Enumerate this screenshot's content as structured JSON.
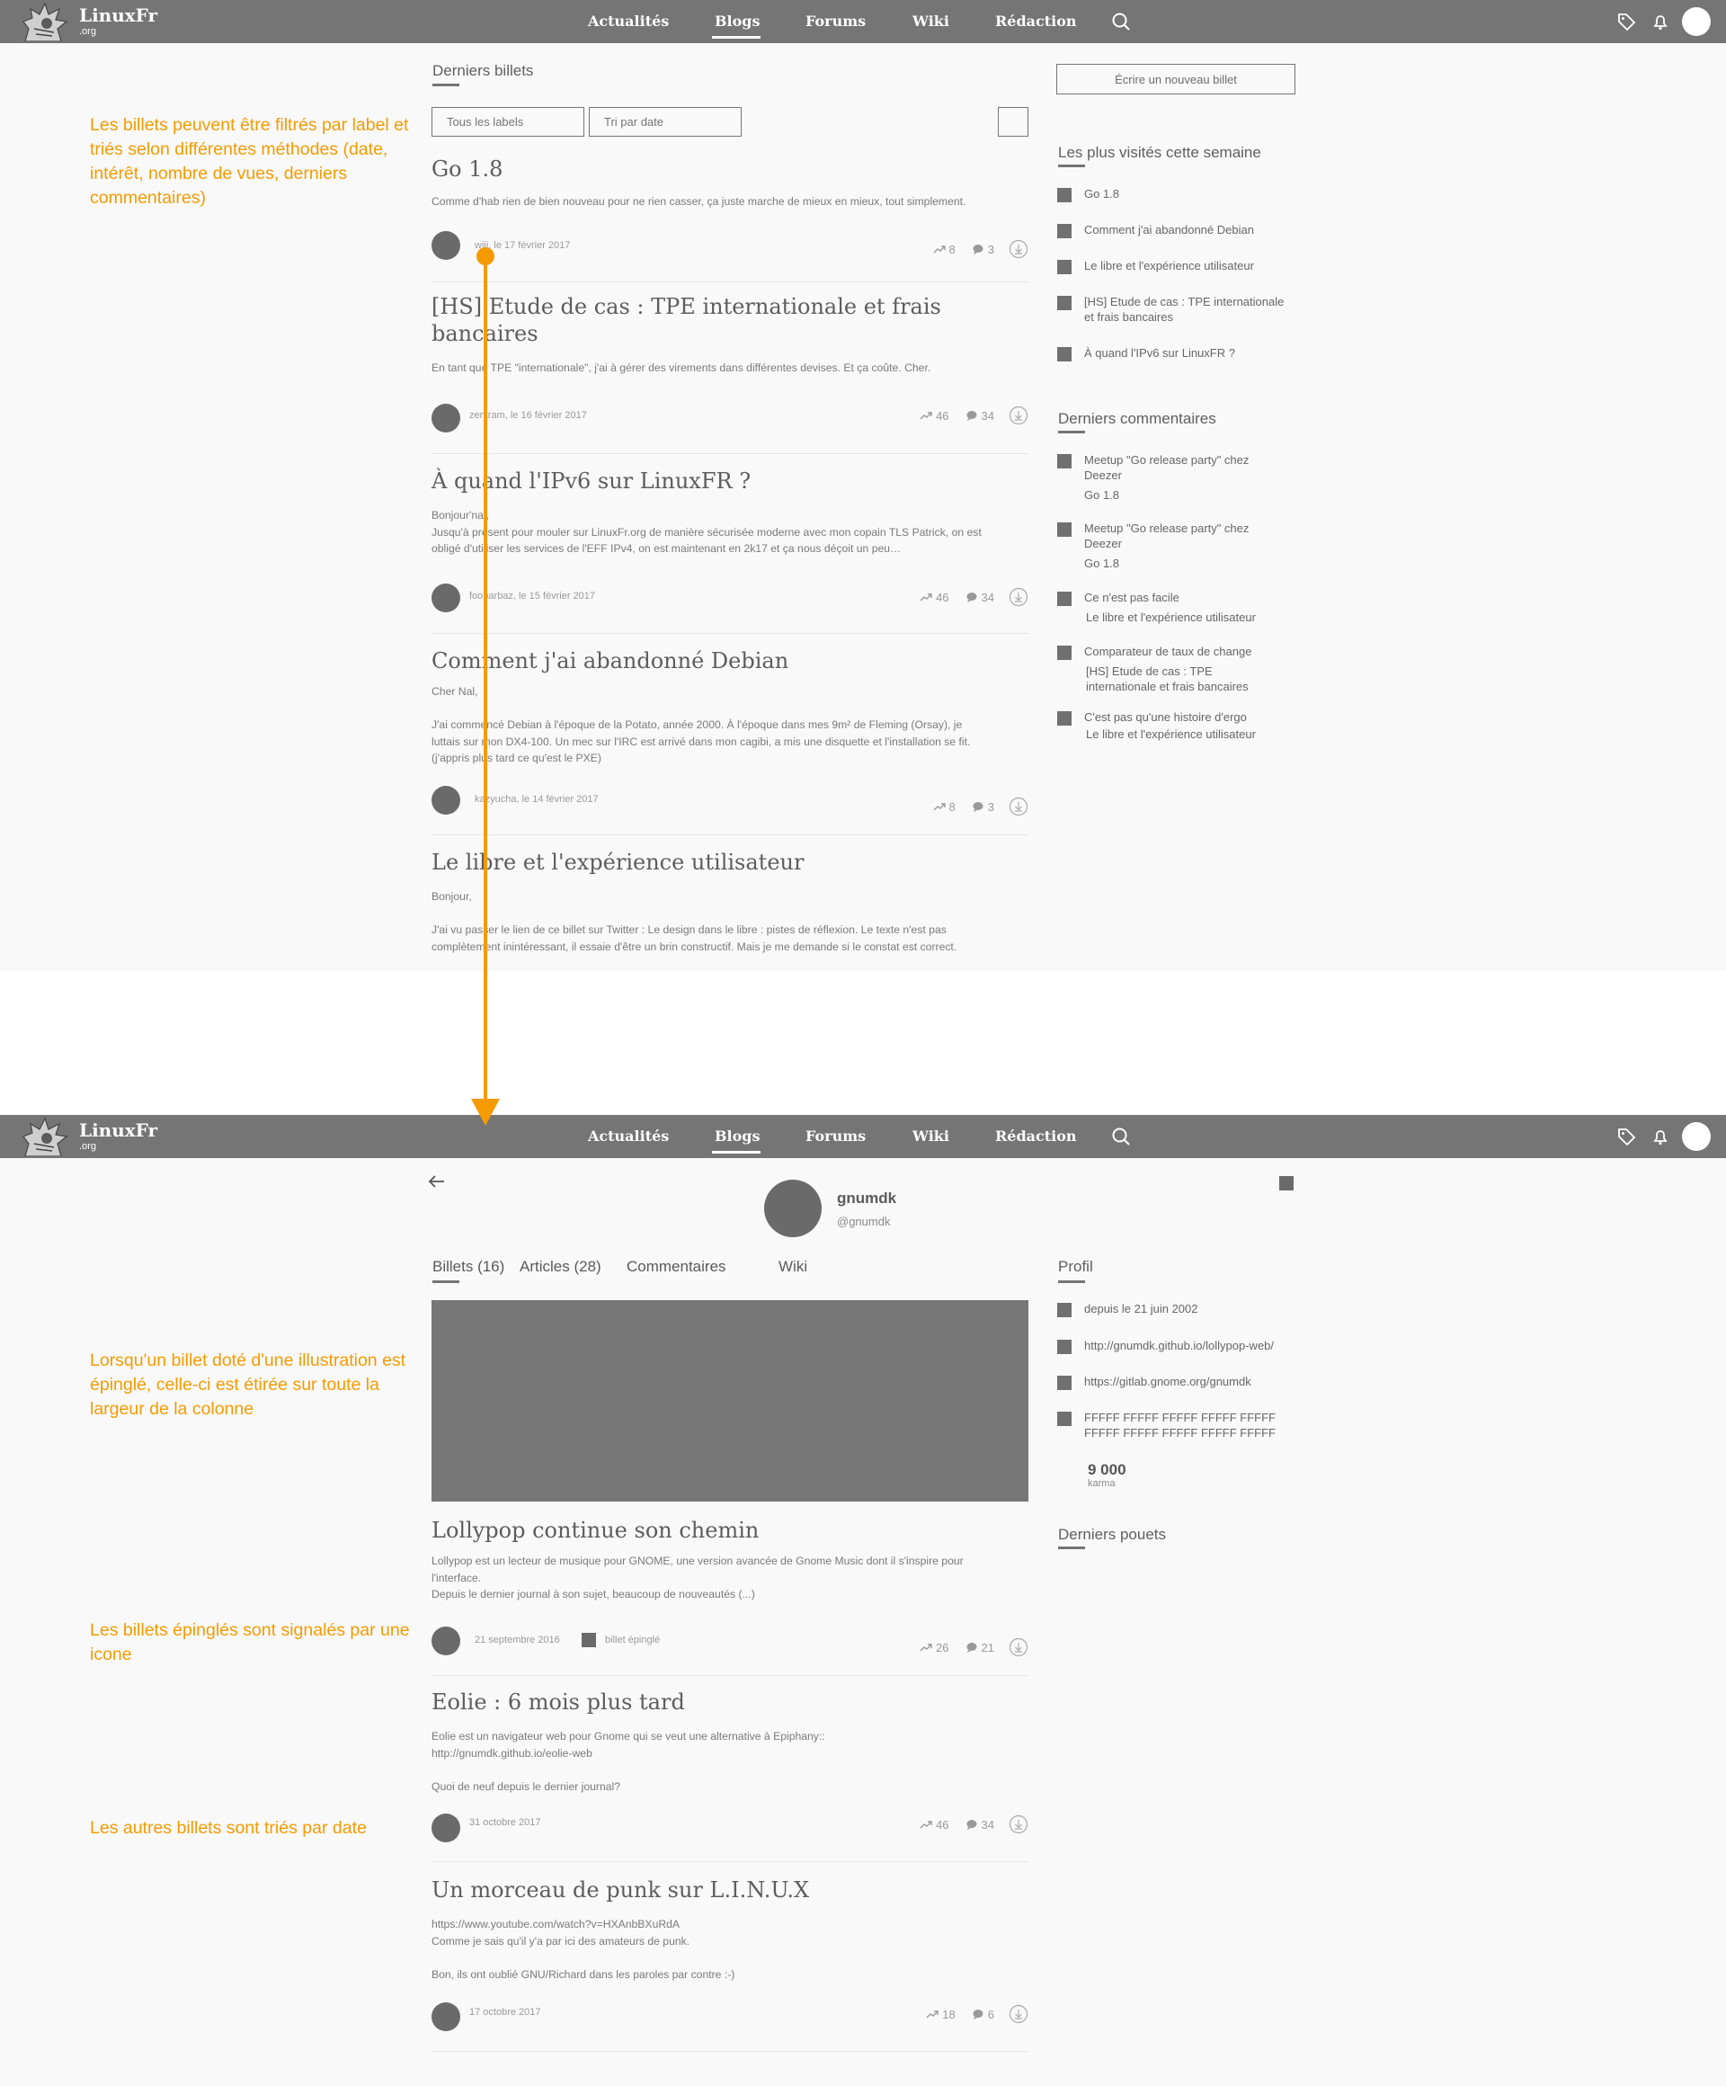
{
  "brand": {
    "name": "LinuxFr",
    "tld": ".org"
  },
  "nav": [
    "Actualités",
    "Blogs",
    "Forums",
    "Wiki",
    "Rédaction"
  ],
  "colors": {
    "header": "#757575",
    "annotation": "#f59b00",
    "background": "#f9f9f9"
  },
  "annotations": {
    "filters": "Les billets peuvent être filtrés par label et triés selon différentes méthodes (date, intérêt, nombre de vues, derniers commentaires)",
    "pinned_illustration": "Lorsqu'un billet doté d'une illustration est épinglé, celle-ci est étirée sur toute la largeur de la colonne",
    "pinned_icon": "Les billets épinglés sont signalés par une icone",
    "sorted_by_date": "Les autres billets sont triés par date"
  },
  "list_view": {
    "section_title": "Derniers billets",
    "filters": {
      "labels": "Tous les labels",
      "sort": "Tri par date"
    },
    "write_button": "Écrire un nouveau billet",
    "posts": [
      {
        "title_lines": [
          "Go 1.8"
        ],
        "excerpt_lines": [
          "Comme d'hab rien de bien nouveau pour ne rien casser, ça juste marche de mieux en mieux, tout simplement."
        ],
        "meta": "wiji, le 17 février 2017",
        "stats": {
          "interest": "8",
          "comments": "3"
        }
      },
      {
        "title_lines": [
          "[HS] Etude de cas : TPE internationale et frais",
          "bancaires"
        ],
        "excerpt_lines": [
          "En tant que TPE \"internationale\", j'ai à gérer des virements dans différentes devises. Et ça coûte. Cher."
        ],
        "meta": "zentram, le 16 février 2017",
        "stats": {
          "interest": "46",
          "comments": "34"
        }
      },
      {
        "title_lines": [
          "À quand l'IPv6 sur LinuxFR ?"
        ],
        "excerpt_lines": [
          "Bonjour'nal,",
          "Jusqu'à présent pour mouler sur LinuxFr.org de manière sécurisée moderne avec mon copain TLS Patrick, on est",
          "obligé d'utiliser les services de l'EFF IPv4, on est maintenant en 2k17 et ça nous déçoit un peu…"
        ],
        "meta": "foobarbaz, le 15 février 2017",
        "stats": {
          "interest": "46",
          "comments": "34"
        }
      },
      {
        "title_lines": [
          "Comment j'ai abandonné Debian"
        ],
        "excerpt_lines": [
          "Cher Nal,",
          "",
          "J'ai commencé Debian à l'époque de la Potato, année 2000. À l'époque dans mes 9m² de Fleming (Orsay), je",
          "luttais sur mon DX4-100. Un mec sur l'IRC est arrivé dans mon cagibi, a mis une disquette et l'installation se fit.",
          "(j'appris plus tard ce qu'est le PXE)"
        ],
        "meta": "kazyucha, le 14 février 2017",
        "stats": {
          "interest": "8",
          "comments": "3"
        }
      },
      {
        "title_lines": [
          "Le libre et l'expérience utilisateur"
        ],
        "excerpt_lines": [
          "Bonjour,",
          "",
          "J'ai vu passer le lien de ce billet sur Twitter : Le design dans le libre : pistes de réflexion. Le texte n'est pas",
          "complètement inintéressant, il essaie d'être un brin constructif. Mais je me demande si le constat est correct."
        ],
        "meta": "",
        "stats": null
      }
    ],
    "most_visited": {
      "title": "Les plus visités cette semaine",
      "items": [
        "Go 1.8",
        "Comment j'ai abandonné Debian",
        "Le libre et l'expérience utilisateur",
        "[HS] Etude de cas : TPE internationale\net frais bancaires",
        "À quand l'IPv6 sur LinuxFR ?"
      ]
    },
    "latest_comments": {
      "title": "Derniers commentaires",
      "items": [
        {
          "comment": "Meetup \"Go release party\" chez\nDeezer",
          "post": "Go 1.8"
        },
        {
          "comment": "Meetup \"Go release party\" chez\nDeezer",
          "post": "Go 1.8"
        },
        {
          "comment": "Ce n'est pas facile",
          "post": "Le libre et l'expérience utilisateur"
        },
        {
          "comment": "Comparateur de taux de change",
          "post": "[HS] Etude de cas : TPE\ninternationale et frais bancaires"
        },
        {
          "comment": "C'est pas qu'une histoire d'ergo",
          "post": "Le libre et l'expérience utilisateur"
        }
      ]
    }
  },
  "profile_view": {
    "name": "gnumdk",
    "handle": "@gnumdk",
    "tabs": [
      "Billets (16)",
      "Articles (28)",
      "Commentaires",
      "Wiki"
    ],
    "posts": [
      {
        "title": "Lollypop continue son chemin",
        "excerpt_lines": [
          "Lollypop est un lecteur de musique pour GNOME, une version avancée de Gnome Music dont il s'inspire pour",
          "l'interface.",
          "Depuis le dernier journal à son sujet, beaucoup de nouveautés (...)"
        ],
        "date": "21 septembre 2016",
        "pinned_label": "billet épinglé",
        "stats": {
          "interest": "26",
          "comments": "21"
        }
      },
      {
        "title": "Eolie : 6 mois plus tard",
        "excerpt_lines": [
          "Eolie est un navigateur web pour Gnome qui se veut une alternative à Epiphany::",
          "http://gnumdk.github.io/eolie-web",
          "",
          "Quoi de neuf depuis le dernier journal?"
        ],
        "date": "31 octobre 2017",
        "pinned_label": "",
        "stats": {
          "interest": "46",
          "comments": "34"
        }
      },
      {
        "title": "Un morceau de punk sur L.I.N.U.X",
        "excerpt_lines": [
          "https://www.youtube.com/watch?v=HXAnbBXuRdA",
          "Comme je sais qu'il y'a par ici des amateurs de punk.",
          "",
          "Bon, ils ont oublié GNU/Richard dans les paroles par contre :-)"
        ],
        "date": "17 octobre 2017",
        "pinned_label": "",
        "stats": {
          "interest": "18",
          "comments": "6"
        }
      }
    ],
    "profile_box": {
      "title": "Profil",
      "items": [
        "depuis le 21 juin 2002",
        "http://gnumdk.github.io/lollypop-web/",
        "https://gitlab.gnome.org/gnumdk",
        "FFFFF FFFFF FFFFF FFFFF FFFFF\nFFFFF FFFFF FFFFF FFFFF FFFFF"
      ],
      "karma_value": "9 000",
      "karma_label": "karma"
    },
    "latest_pouets_title": "Derniers pouets"
  }
}
